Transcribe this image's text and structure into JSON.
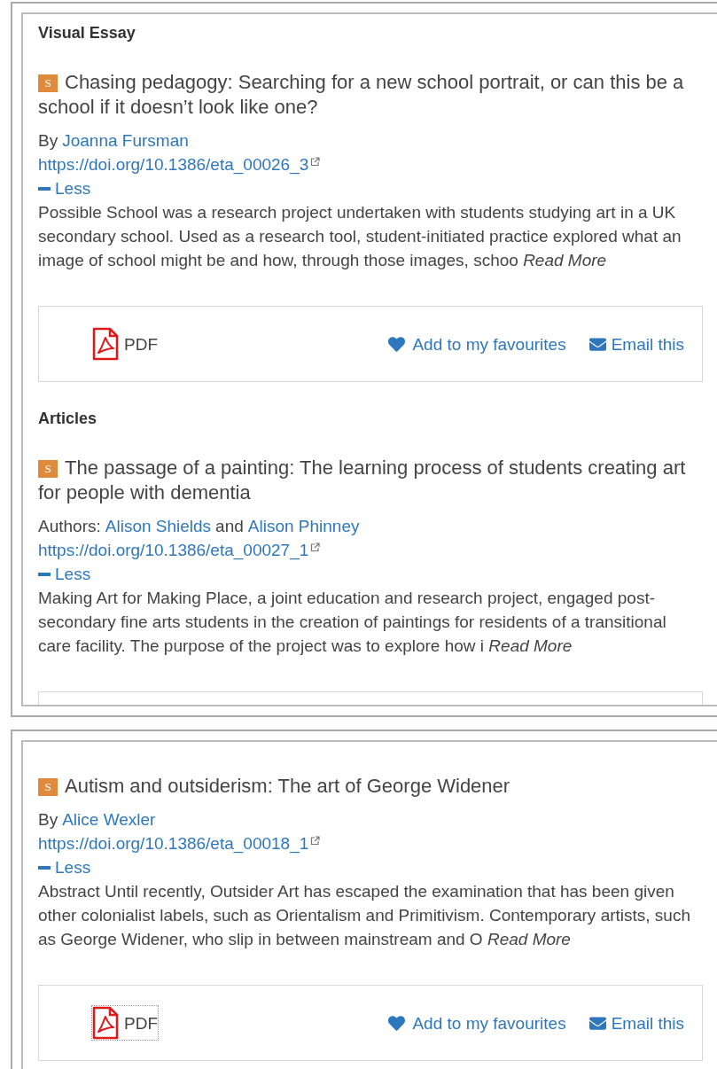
{
  "panels": [
    {
      "clipped": true,
      "sections": [
        {
          "heading": "Visual Essay",
          "articles": [
            {
              "badge": "S",
              "title": "Chasing pedagogy: Searching for a new school portrait, or can this be a school if it doesn’t look like one?",
              "byline": {
                "prefix": "By",
                "authors": [
                  "Joanna Fursman"
                ]
              },
              "doi": "https://doi.org/10.1386/eta_00026_3",
              "toggle": {
                "label": "Less",
                "expanded": true
              },
              "abstract": "Possible School was a research project undertaken with students studying art in a UK secondary school. Used as a research tool, student-initiated practice explored what an image of school might be and how, through those images, schoo",
              "read_more": "Read More",
              "actions": {
                "pdf": "PDF",
                "pdf_focused": false,
                "favourite": "Add to my favourites",
                "email": "Email this"
              }
            }
          ]
        },
        {
          "heading": "Articles",
          "articles": [
            {
              "badge": "S",
              "title": "The passage of a painting: The learning process of students creating art for people with dementia",
              "byline": {
                "prefix": "Authors:",
                "authors": [
                  "Alison Shields",
                  "Alison Phinney"
                ],
                "joiner": "and"
              },
              "doi": "https://doi.org/10.1386/eta_00027_1",
              "toggle": {
                "label": "Less",
                "expanded": true
              },
              "abstract": "Making Art for Making Place, a joint education and research project, engaged post-secondary fine arts students in the creation of paintings for residents of a transitional care facility. The purpose of the project was to explore how i",
              "read_more": "Read More"
            }
          ]
        }
      ]
    },
    {
      "clipped": false,
      "sections": [
        {
          "articles": [
            {
              "badge": "S",
              "title": "Autism and outsiderism: The art of George Widener",
              "byline": {
                "prefix": "By",
                "authors": [
                  "Alice Wexler"
                ]
              },
              "doi": "https://doi.org/10.1386/eta_00018_1",
              "toggle": {
                "label": "Less",
                "expanded": true
              },
              "abstract": "Abstract Until recently, Outsider Art has escaped the examination that has been given other colonialist labels, such as Orientalism and Primitivism. Contemporary artists, such as George Widener, who slip in between mainstream and O",
              "read_more": "Read More",
              "actions": {
                "pdf": "PDF",
                "pdf_focused": true,
                "favourite": "Add to my favourites",
                "email": "Email this"
              }
            }
          ]
        }
      ]
    }
  ]
}
